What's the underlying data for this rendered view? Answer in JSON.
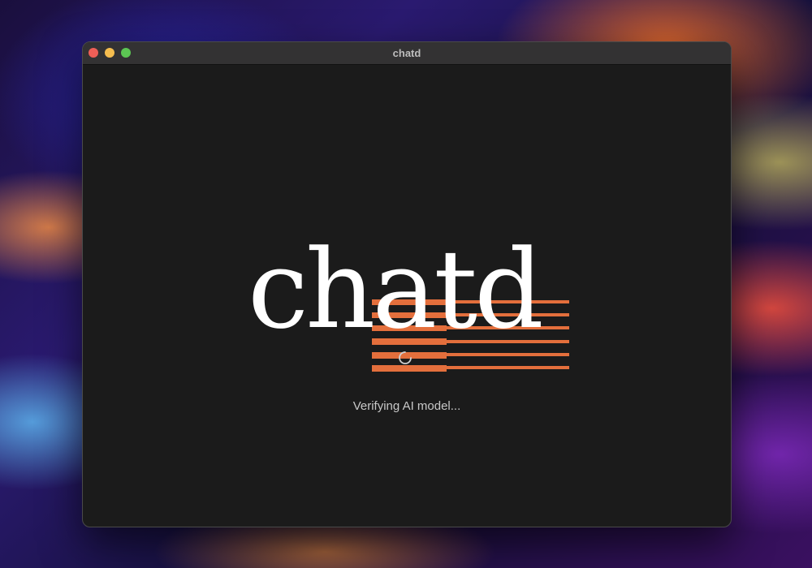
{
  "window": {
    "title": "chatd"
  },
  "logo": {
    "wordmark": "chatd",
    "accent_color": "#e46f3c",
    "text_color": "#ffffff"
  },
  "loading": {
    "status_text": "Verifying AI model..."
  },
  "colors": {
    "window_bg": "#1b1b1b",
    "titlebar_bg": "#333233"
  }
}
